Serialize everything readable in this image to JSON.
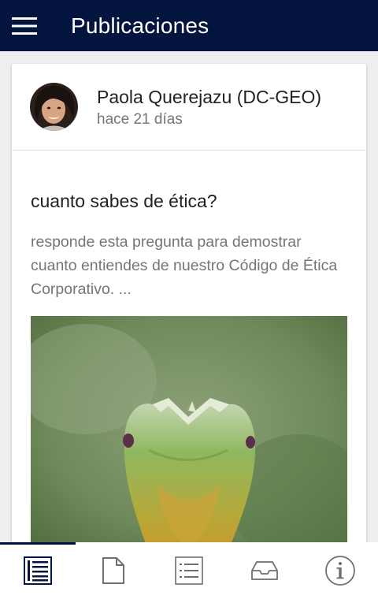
{
  "app_bar": {
    "title": "Publicaciones",
    "menu_icon": "hamburger-menu-icon",
    "background": "#03143f"
  },
  "post": {
    "author": "Paola Querejazu (DC-GEO)",
    "time": "hace 21 días",
    "title": "cuanto sabes de ética?",
    "excerpt": "responde esta pregunta para demostrar cuanto entiendes de nuestro Código de Ética Corporativo. ..."
  },
  "bottom_nav": {
    "items": [
      {
        "icon": "news-feed-icon",
        "active": true
      },
      {
        "icon": "document-icon",
        "active": false
      },
      {
        "icon": "list-icon",
        "active": false
      },
      {
        "icon": "inbox-icon",
        "active": false
      },
      {
        "icon": "info-icon",
        "active": false
      }
    ],
    "active_color": "#03143f",
    "inactive_color": "#6f6f6f"
  }
}
